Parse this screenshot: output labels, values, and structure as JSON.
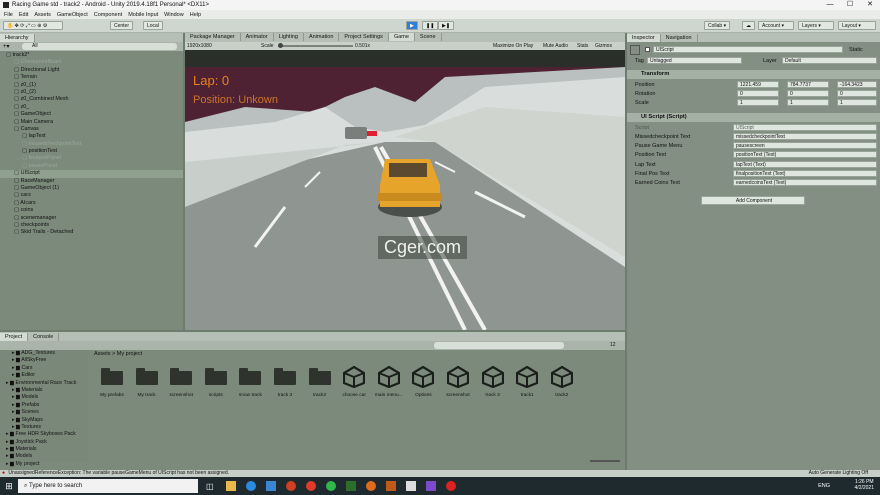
{
  "window": {
    "title": "Racing Game std - track2 - Android - Unity 2019.4.18f1 Personal* <DX11>",
    "controls": [
      "—",
      "☐",
      "✕"
    ]
  },
  "menu": [
    "File",
    "Edit",
    "Assets",
    "GameObject",
    "Component",
    "Mobile Input",
    "Window",
    "Help"
  ],
  "toolbar": {
    "center": "Center",
    "local": "Local",
    "collab": "Collab",
    "account": "Account",
    "layers": "Layers",
    "layout": "Layout"
  },
  "hierarchy": {
    "tab": "Hierarchy",
    "search": "All",
    "items": [
      {
        "label": "track2*",
        "indent": 0,
        "dim": false
      },
      {
        "label": "CheckpointBeam",
        "indent": 1,
        "dim": true
      },
      {
        "label": "Directional Light",
        "indent": 1,
        "dim": false
      },
      {
        "label": "Terrain",
        "indent": 1,
        "dim": false
      },
      {
        "label": "z0_(1)",
        "indent": 1,
        "dim": false
      },
      {
        "label": "z0_(2)",
        "indent": 1,
        "dim": false
      },
      {
        "label": "z0_Combined Mesh",
        "indent": 1,
        "dim": false
      },
      {
        "label": "z0_",
        "indent": 1,
        "dim": false
      },
      {
        "label": "GameObject",
        "indent": 1,
        "dim": false
      },
      {
        "label": "Main Camera",
        "indent": 1,
        "dim": false
      },
      {
        "label": "Canvas",
        "indent": 1,
        "dim": false
      },
      {
        "label": "lapText",
        "indent": 2,
        "dim": false
      },
      {
        "label": "missedcheckpointText",
        "indent": 2,
        "dim": true
      },
      {
        "label": "positionText",
        "indent": 2,
        "dim": false
      },
      {
        "label": "finalposPanel",
        "indent": 2,
        "dim": true
      },
      {
        "label": "pausePanel",
        "indent": 2,
        "dim": true
      },
      {
        "label": "UIScript",
        "indent": 1,
        "dim": false,
        "sel": true
      },
      {
        "label": "RaceManager",
        "indent": 1,
        "dim": false
      },
      {
        "label": "GameObject (1)",
        "indent": 1,
        "dim": false
      },
      {
        "label": "cars",
        "indent": 1,
        "dim": false
      },
      {
        "label": "AIcars",
        "indent": 1,
        "dim": false
      },
      {
        "label": "coins",
        "indent": 1,
        "dim": false
      },
      {
        "label": "scenemanager",
        "indent": 1,
        "dim": false
      },
      {
        "label": "checkpoints",
        "indent": 1,
        "dim": false
      },
      {
        "label": "Skid Trails - Detached",
        "indent": 1,
        "dim": false
      }
    ]
  },
  "game": {
    "tabs": [
      "Package Manager",
      "Animator",
      "Lighting",
      "Animation",
      "Project Settings",
      "Game",
      "Scene"
    ],
    "resolution": "1920x1080",
    "scale_label": "Scale",
    "scale_value": "0.501x",
    "buttons": [
      "Maximize On Play",
      "Mute Audio",
      "Stats",
      "Gizmos"
    ],
    "hud": {
      "lap": "Lap: 0",
      "position": "Position: Unkown"
    }
  },
  "watermark": "Cger.com",
  "inspector": {
    "tabs": [
      "Inspector",
      "Navigation"
    ],
    "name": "UIScript",
    "static": "Static",
    "tag_label": "Tag",
    "tag": "Untagged",
    "layer_label": "Layer",
    "layer": "Default",
    "transform": {
      "title": "Transform",
      "position": {
        "label": "Position",
        "x": "1221.459",
        "y": "784.7737",
        "z": "-164.3423"
      },
      "rotation": {
        "label": "Rotation",
        "x": "0",
        "y": "0",
        "z": "0"
      },
      "scale": {
        "label": "Scale",
        "x": "1",
        "y": "1",
        "z": "1"
      }
    },
    "script": {
      "title": "UI Script (Script)",
      "script_label": "Script",
      "script_value": "UIScript",
      "fields": [
        {
          "label": "Missedcheckpoint Text",
          "value": "missedcheckpointText"
        },
        {
          "label": "Pause Game Menu",
          "value": "pausescreen"
        },
        {
          "label": "Position Text",
          "value": "positionText (Text)"
        },
        {
          "label": "Lap Text",
          "value": "lapText (Text)"
        },
        {
          "label": "Final Pos Text",
          "value": "finalpositionText (Text)"
        },
        {
          "label": "Earned Coins Text",
          "value": "earnedcoinsText (Text)"
        }
      ]
    },
    "add_component": "Add Component"
  },
  "project": {
    "tabs": [
      "Project",
      "Console"
    ],
    "breadcrumb": "Assets > My project",
    "count": "12",
    "tree": [
      "ADG_Textures",
      "AllSkyFree",
      "Cars",
      "Editor",
      "Environmental Race Track",
      "Materials",
      "Models",
      "Prefabs",
      "Scenes",
      "SkyMaps",
      "Textures",
      "Free HDR Skyboxes Pack",
      "Joystick Pack",
      "Materials",
      "Models",
      "My project"
    ],
    "assets": [
      {
        "label": "My prefabs",
        "kind": "folder"
      },
      {
        "label": "My track",
        "kind": "folder"
      },
      {
        "label": "screenshot",
        "kind": "folder"
      },
      {
        "label": "scripts",
        "kind": "folder"
      },
      {
        "label": "snow track",
        "kind": "folder"
      },
      {
        "label": "track 3",
        "kind": "folder"
      },
      {
        "label": "track2",
        "kind": "folder"
      },
      {
        "label": "choose car",
        "kind": "unity"
      },
      {
        "label": "main menu...",
        "kind": "unity"
      },
      {
        "label": "Options",
        "kind": "unity"
      },
      {
        "label": "screenshot",
        "kind": "unity"
      },
      {
        "label": "track 3",
        "kind": "unity"
      },
      {
        "label": "track1",
        "kind": "unity"
      },
      {
        "label": "track2",
        "kind": "unity"
      }
    ]
  },
  "status": {
    "warning": "UnassignedReferenceException: The variable pauseGameMenu of UIScript has not been assigned.",
    "right": "Auto Generate Lighting Off"
  },
  "taskbar": {
    "search": "Type here to search",
    "lang": "ENG",
    "time": "1:26 PM",
    "date": "4/2/2021"
  }
}
